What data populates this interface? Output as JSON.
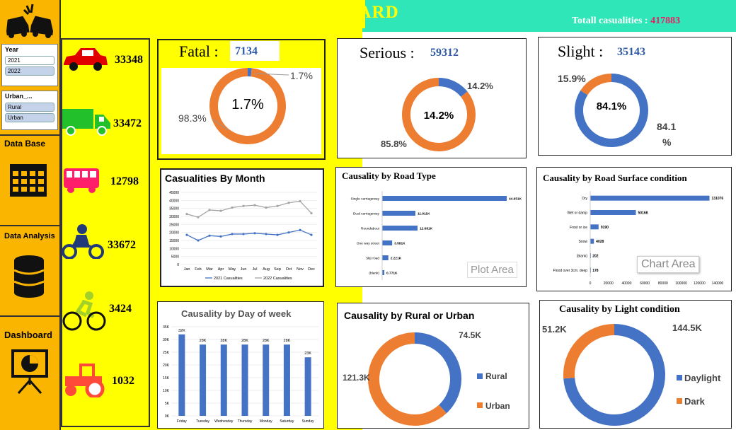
{
  "header": {
    "title": "U.K ROAD ACCIDENT  DASHBOARD",
    "total_label": "Totall casualities : ",
    "total_value": "417883"
  },
  "colors": {
    "blue": "#4472c4",
    "orange": "#ed7d31",
    "yellow": "#ffff00",
    "teal": "#2ee6b7",
    "nav": "#f9b500",
    "gray": "#a5a5a5"
  },
  "slicers": {
    "year": {
      "title": "Year",
      "items": [
        "2021",
        "2022"
      ]
    },
    "urban": {
      "title": "Urban_...",
      "items": [
        "Rural",
        "Urban"
      ]
    }
  },
  "nav": {
    "database": "Data Base",
    "analysis": "Data Analysis",
    "dashboard": "Dashboard"
  },
  "vehicles": [
    {
      "icon": "car-icon",
      "value": "33348"
    },
    {
      "icon": "truck-icon",
      "value": "33472"
    },
    {
      "icon": "bus-icon",
      "value": "12798"
    },
    {
      "icon": "motorcycle-icon",
      "value": "33672"
    },
    {
      "icon": "bicycle-icon",
      "value": "3424"
    },
    {
      "icon": "tractor-icon",
      "value": "1032"
    }
  ],
  "kpis": {
    "fatal": {
      "label": "Fatal :",
      "value": "7134",
      "pct_slice": 1.7,
      "pct_label": "1.7%",
      "center": "1.7%",
      "other_label": "98.3%"
    },
    "serious": {
      "label": "Serious :",
      "value": "59312",
      "pct_slice": 14.2,
      "pct_label": "14.2%",
      "center": "14.2%",
      "other_label": "85.8%"
    },
    "slight": {
      "label": "Slight :",
      "value": "35143",
      "pct_slice": 84.1,
      "pct_label": "84.1",
      "pct_label2": "%",
      "center": "84.1%",
      "other_label": "15.9%"
    }
  },
  "chart_data": [
    {
      "id": "month",
      "type": "line",
      "title": "Casualities By Month",
      "categories": [
        "Jan",
        "Feb",
        "Mar",
        "Apr",
        "May",
        "Jun",
        "Jul",
        "Aug",
        "Sep",
        "Oct",
        "Nov",
        "Dec"
      ],
      "series": [
        {
          "name": "2021 Casualities",
          "values": [
            18500,
            15000,
            18000,
            17500,
            19000,
            19000,
            19500,
            19000,
            18500,
            20000,
            21500,
            18500
          ]
        },
        {
          "name": "2022 Casualities",
          "values": [
            31500,
            29500,
            34000,
            33500,
            35500,
            36500,
            37000,
            35500,
            36500,
            38500,
            39500,
            32000
          ]
        }
      ],
      "yticks": [
        "0",
        "5000",
        "10000",
        "15000",
        "20000",
        "25000",
        "30000",
        "35000",
        "40000",
        "45000"
      ],
      "ylim": [
        0,
        45000
      ]
    },
    {
      "id": "road",
      "type": "bar",
      "title": "Causality by Road Type",
      "categories": [
        "Single carriageway",
        "Dual carriageway",
        "Roundabout",
        "One way street",
        "Slip road",
        "(blank)"
      ],
      "values": [
        44651,
        11911,
        12681,
        3581,
        2221,
        771
      ],
      "labels": [
        "44.651K",
        "11.911K",
        "12.681K",
        "3.581K",
        "2.221K",
        "0.771K"
      ],
      "overlay": "Plot Area"
    },
    {
      "id": "surface",
      "type": "bar",
      "title": "Causality by Road Surface condition",
      "categories": [
        "Dry",
        "Wet or damp",
        "Frost or ice",
        "Snow",
        "(blank)",
        "Flood over 3cm. deep"
      ],
      "values": [
        131076,
        50168,
        9190,
        4028,
        202,
        178
      ],
      "labels": [
        "131076",
        "50168",
        "9190",
        "4028",
        "202",
        "178"
      ],
      "xticks": [
        "0",
        "20000",
        "40000",
        "60000",
        "80000",
        "100000",
        "120000",
        "140000"
      ],
      "xlim": [
        0,
        140000
      ],
      "overlay": "Chart Area"
    },
    {
      "id": "day",
      "type": "bar",
      "title": "Causality by Day of week",
      "categories": [
        "Friday",
        "Tuesday",
        "Wednesday",
        "Thursday",
        "Monday",
        "Saturday",
        "Sunday"
      ],
      "values": [
        32000,
        28000,
        28000,
        28000,
        28000,
        28000,
        23000
      ],
      "labels": [
        "32K",
        "28K",
        "28K",
        "28K",
        "28K",
        "28K",
        "23K"
      ],
      "yticks": [
        "0K",
        "5K",
        "10K",
        "15K",
        "20K",
        "25K",
        "30K",
        "35K"
      ],
      "ylim": [
        0,
        35000
      ]
    },
    {
      "id": "rural",
      "type": "pie",
      "title": "Causality by Rural or Urban",
      "slices": [
        {
          "name": "Rural",
          "value": 74.5,
          "label": "74.5K"
        },
        {
          "name": "Urban",
          "value": 121.3,
          "label": "121.3K"
        }
      ]
    },
    {
      "id": "light",
      "type": "pie",
      "title": "Causality by  Light condition",
      "slices": [
        {
          "name": "Daylight",
          "value": 144.5,
          "label": "144.5K"
        },
        {
          "name": "Dark",
          "value": 51.2,
          "label": "51.2K"
        }
      ]
    }
  ]
}
